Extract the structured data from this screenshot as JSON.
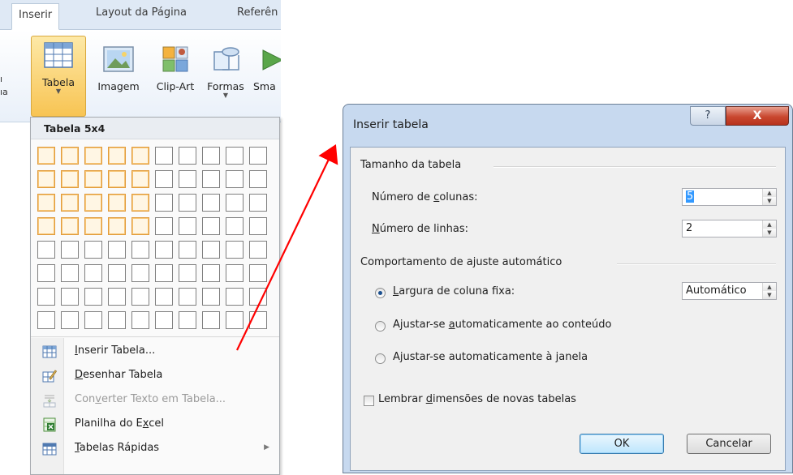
{
  "ribbon": {
    "tabs": [
      "Inserir",
      "Layout da Página",
      "Referên"
    ],
    "buttons": [
      {
        "label": "Tabela",
        "icon": "table-icon"
      },
      {
        "label": "Imagem",
        "icon": "picture-icon"
      },
      {
        "label": "Clip-Art",
        "icon": "clipart-icon"
      },
      {
        "label": "Formas",
        "icon": "shapes-icon"
      },
      {
        "label": "Sma",
        "icon": "smartart-icon"
      }
    ],
    "left_fragments": [
      "ı",
      "ıa"
    ]
  },
  "table_menu": {
    "header": "Tabela 5x4",
    "grid": {
      "columns": 10,
      "rows": 8,
      "selected_columns": 5,
      "selected_rows": 4
    },
    "items": [
      {
        "label": "Inserir Tabela...",
        "mnemonic": "I",
        "icon": "insert-table-icon",
        "enabled": true
      },
      {
        "label": "Desenhar Tabela",
        "mnemonic": "D",
        "icon": "draw-table-icon",
        "enabled": true
      },
      {
        "label": "Converter Texto em Tabela...",
        "mnemonic": "v",
        "icon": "convert-text-icon",
        "enabled": false
      },
      {
        "label": "Planilha do Excel",
        "mnemonic": "x",
        "icon": "excel-icon",
        "enabled": true
      },
      {
        "label": "Tabelas Rápidas",
        "mnemonic": "T",
        "icon": "quick-tables-icon",
        "enabled": true,
        "submenu": true
      }
    ]
  },
  "dialog": {
    "title": "Inserir tabela",
    "help_label": "?",
    "close_label": "X",
    "size_group": "Tamanho da tabela",
    "columns_label": "Número de colunas:",
    "columns_value": "5",
    "rows_label": "Número de linhas:",
    "rows_value": "2",
    "autofit_group": "Comportamento de ajuste automático",
    "fixed_width_label": "Largura de coluna fixa:",
    "fixed_width_value": "Automático",
    "autofit_content_label": "Ajustar-se automaticamente ao conteúdo",
    "autofit_window_label": "Ajustar-se automaticamente à janela",
    "remember_label": "Lembrar dimensões de novas tabelas",
    "ok_label": "OK",
    "cancel_label": "Cancelar",
    "selected_option": "fixed_width",
    "remember_checked": false
  },
  "colors": {
    "arrow": "#ff0000",
    "selection_orange": "#e19b3b",
    "dialog_frame": "#c7d9ef",
    "close_red": "#c9472f"
  }
}
